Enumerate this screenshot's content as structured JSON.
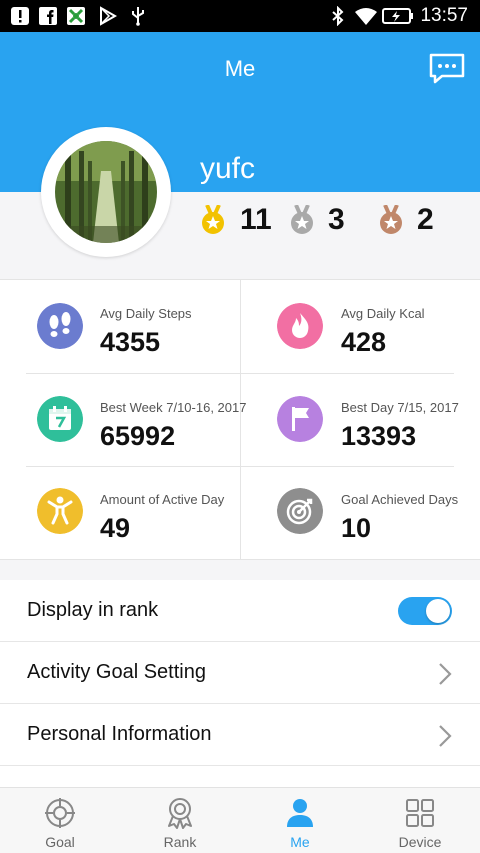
{
  "status_bar": {
    "time": "13:57"
  },
  "header": {
    "title": "Me"
  },
  "profile": {
    "username": "yufc"
  },
  "medals": [
    {
      "type": "gold",
      "count": "11",
      "color": "#f2c200"
    },
    {
      "type": "silver",
      "count": "3",
      "color": "#a9a9a9"
    },
    {
      "type": "bronze",
      "count": "2",
      "color": "#c0876a"
    }
  ],
  "stats": [
    {
      "label": "Avg Daily Steps",
      "value": "4355",
      "icon": "footprints-icon",
      "color": "#6b7ccf"
    },
    {
      "label": "Avg Daily Kcal",
      "value": "428",
      "icon": "flame-icon",
      "color": "#f26fa3"
    },
    {
      "label": "Best Week  7/10-16, 2017",
      "value": "65992",
      "icon": "calendar-icon",
      "color": "#2fbf9a"
    },
    {
      "label": "Best Day  7/15, 2017",
      "value": "13393",
      "icon": "flag-icon",
      "color": "#b781e0"
    },
    {
      "label": "Amount of Active Day",
      "value": "49",
      "icon": "person-active-icon",
      "color": "#f0be2c"
    },
    {
      "label": "Goal Achieved Days",
      "value": "10",
      "icon": "target-icon",
      "color": "#8e8e8e"
    }
  ],
  "settings": [
    {
      "label": "Display in rank",
      "control": "toggle",
      "on": true
    },
    {
      "label": "Activity Goal Setting",
      "control": "chevron"
    },
    {
      "label": "Personal Information",
      "control": "chevron"
    }
  ],
  "tabs": [
    {
      "label": "Goal",
      "icon": "crosshair-icon",
      "active": false
    },
    {
      "label": "Rank",
      "icon": "medal-ribbon-icon",
      "active": false
    },
    {
      "label": "Me",
      "icon": "person-icon",
      "active": true
    },
    {
      "label": "Device",
      "icon": "grid-icon",
      "active": false
    }
  ],
  "colors": {
    "accent": "#29a3f0",
    "background": "#f5f5f7"
  }
}
